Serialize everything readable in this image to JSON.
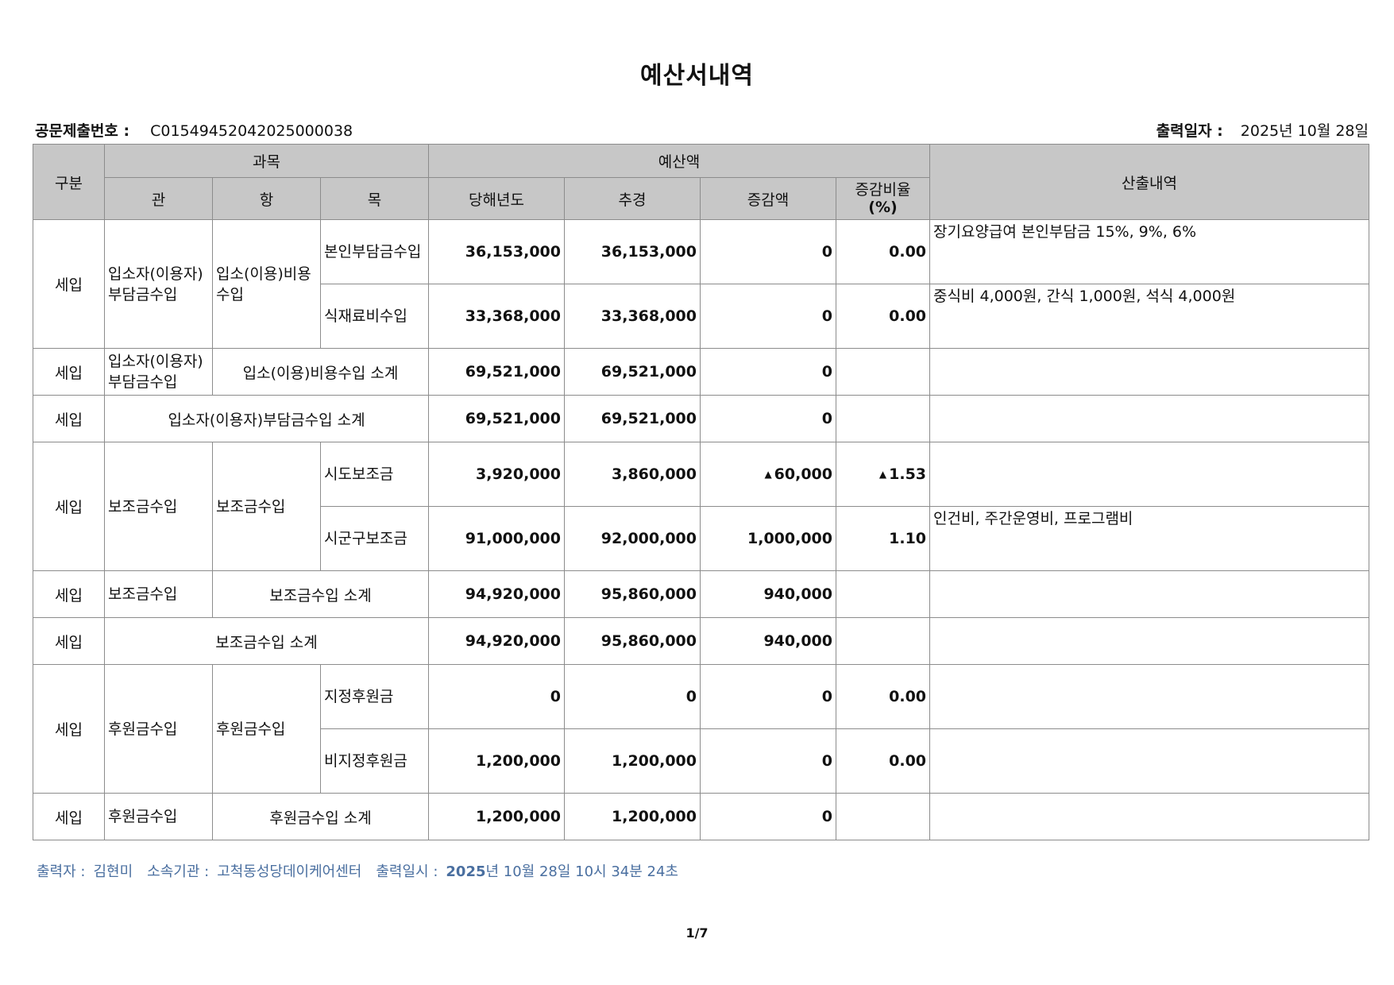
{
  "title": "예산서내역",
  "doc_number_label": "공문제출번호 :",
  "doc_number": "C01549452042025000038",
  "print_date_label": "출력일자 :",
  "print_date": "2025년 10월 28일",
  "headers": {
    "gubun": "구분",
    "gwamok": "과목",
    "yesanaek": "예산액",
    "sanchul": "산출내역",
    "gwan": "관",
    "hang": "항",
    "mok": "목",
    "current_year": "당해년도",
    "chugyeong": "추경",
    "change_amount": "증감액",
    "change_ratio_line1": "증감비율",
    "change_ratio_line2": "(%)"
  },
  "rows": {
    "r1": {
      "gubun": "세입",
      "gwan": "입소자(이용자)부담금수입",
      "hang": "입소(이용)비용수입",
      "mok": "본인부담금수입",
      "current": "36,153,000",
      "chugyeong": "36,153,000",
      "change": "0",
      "ratio": "0.00",
      "desc": "장기요양급여 본인부담금 15%, 9%, 6%"
    },
    "r2": {
      "mok": "식재료비수입",
      "current": "33,368,000",
      "chugyeong": "33,368,000",
      "change": "0",
      "ratio": "0.00",
      "desc": "중식비 4,000원, 간식 1,000원, 석식 4,000원"
    },
    "r3": {
      "gubun": "세입",
      "gwan": "입소자(이용자)부담금수입",
      "subtotal": "입소(이용)비용수입 소계",
      "current": "69,521,000",
      "chugyeong": "69,521,000",
      "change": "0"
    },
    "r4": {
      "gubun": "세입",
      "subtotal": "입소자(이용자)부담금수입 소계",
      "current": "69,521,000",
      "chugyeong": "69,521,000",
      "change": "0"
    },
    "r5": {
      "gubun": "세입",
      "gwan": "보조금수입",
      "hang": "보조금수입",
      "mok": "시도보조금",
      "current": "3,920,000",
      "chugyeong": "3,860,000",
      "change_marker": "▲",
      "change": "60,000",
      "ratio_marker": "▲",
      "ratio": "1.53",
      "desc": ""
    },
    "r6": {
      "mok": "시군구보조금",
      "current": "91,000,000",
      "chugyeong": "92,000,000",
      "change": "1,000,000",
      "ratio": "1.10",
      "desc": "인건비, 주간운영비, 프로그램비"
    },
    "r7": {
      "gubun": "세입",
      "gwan": "보조금수입",
      "subtotal": "보조금수입 소계",
      "current": "94,920,000",
      "chugyeong": "95,860,000",
      "change": "940,000"
    },
    "r8": {
      "gubun": "세입",
      "subtotal": "보조금수입 소계",
      "current": "94,920,000",
      "chugyeong": "95,860,000",
      "change": "940,000"
    },
    "r9": {
      "gubun": "세입",
      "gwan": "후원금수입",
      "hang": "후원금수입",
      "mok": "지정후원금",
      "current": "0",
      "chugyeong": "0",
      "change": "0",
      "ratio": "0.00",
      "desc": ""
    },
    "r10": {
      "mok": "비지정후원금",
      "current": "1,200,000",
      "chugyeong": "1,200,000",
      "change": "0",
      "ratio": "0.00",
      "desc": ""
    },
    "r11": {
      "gubun": "세입",
      "gwan": "후원금수입",
      "subtotal": "후원금수입 소계",
      "current": "1,200,000",
      "chugyeong": "1,200,000",
      "change": "0"
    }
  },
  "footer": {
    "printer_label": "출력자 :",
    "printer": "김현미",
    "org_label": "소속기관 :",
    "org": "고척동성당데이케어센터",
    "datetime_label": "출력일시 :",
    "datetime_year": "2025",
    "datetime_rest": "년 10월 28일 10시 34분 24초"
  },
  "page": "1/7"
}
